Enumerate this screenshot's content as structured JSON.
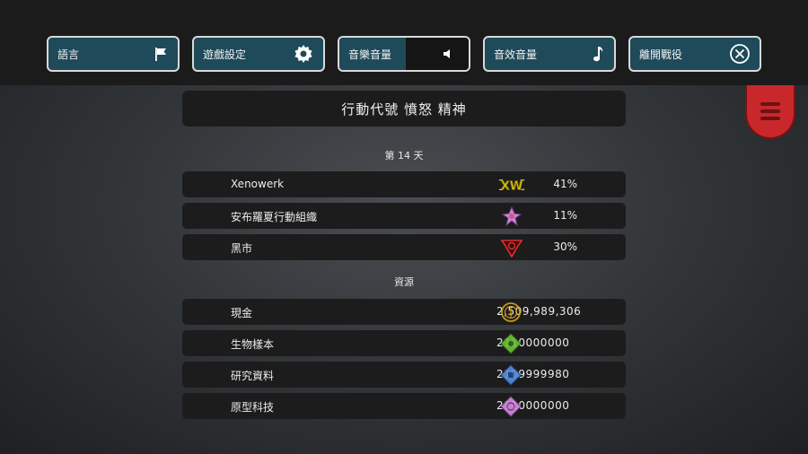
{
  "toolbar": {
    "language_label": "語言",
    "settings_label": "遊戲設定",
    "music_label": "音樂音量",
    "sfx_label": "音效音量",
    "exit_label": "離開戰役"
  },
  "operation_title": "行動代號 憤怒 精神",
  "day_label": "第 14 天",
  "factions": [
    {
      "name": "Xenowerk",
      "percent": "41%",
      "emblem": "xw-emblem-icon"
    },
    {
      "name": "安布羅夏行動組織",
      "percent": "11%",
      "emblem": "ambrosia-emblem-icon"
    },
    {
      "name": "黑市",
      "percent": "30%",
      "emblem": "black-market-emblem-icon"
    }
  ],
  "resources_label": "資源",
  "resources": [
    {
      "name": "現金",
      "amount": "2,509,989,306",
      "icon": "cash-icon",
      "color": "#d6a21e"
    },
    {
      "name": "生物樣本",
      "amount": "2110000000",
      "icon": "bio-sample-icon",
      "color": "#6cc13a"
    },
    {
      "name": "研究資料",
      "amount": "2109999980",
      "icon": "research-data-icon",
      "color": "#5a8fe0"
    },
    {
      "name": "原型科技",
      "amount": "2110000000",
      "icon": "prototype-tech-icon",
      "color": "#d38fe0"
    }
  ],
  "colors": {
    "button_fill": "#1f4a5a",
    "menu_tab": "#c8282b"
  }
}
